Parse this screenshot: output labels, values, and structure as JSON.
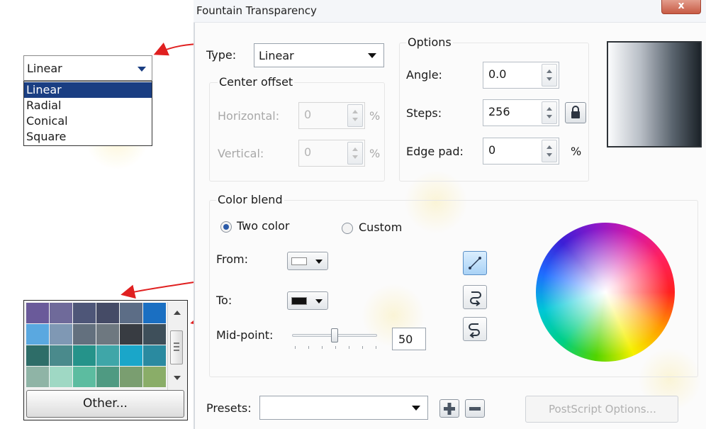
{
  "dialog": {
    "title": "Fountain Transparency",
    "close_label": "x"
  },
  "type": {
    "label": "Type:",
    "value": "Linear",
    "options": [
      "Linear",
      "Radial",
      "Conical",
      "Square"
    ],
    "selected_index": 0
  },
  "center_offset": {
    "title": "Center offset",
    "horizontal_label": "Horizontal:",
    "horizontal_value": "0",
    "vertical_label": "Vertical:",
    "vertical_value": "0",
    "unit": "%"
  },
  "options": {
    "title": "Options",
    "angle_label": "Angle:",
    "angle_value": "0.0",
    "steps_label": "Steps:",
    "steps_value": "256",
    "edge_pad_label": "Edge pad:",
    "edge_pad_value": "0",
    "unit": "%"
  },
  "color_blend": {
    "title": "Color blend",
    "two_color_label": "Two color",
    "custom_label": "Custom",
    "selected": "two_color",
    "from_label": "From:",
    "from_color": "#ffffff",
    "to_label": "To:",
    "to_color": "#111111",
    "midpoint_label": "Mid-point:",
    "midpoint_value": "50"
  },
  "presets": {
    "label": "Presets:",
    "value": "",
    "postscript_label": "PostScript Options..."
  },
  "palette": {
    "other_label": "Other...",
    "colors": [
      "#6a5a9a",
      "#6f6a9a",
      "#4e5678",
      "#454b66",
      "#5c6d86",
      "#1a6fc2",
      "#5aa8e0",
      "#7f98b4",
      "#63707e",
      "#6e7880",
      "#383c42",
      "#3e4f5a",
      "#2e6d68",
      "#4a8a8c",
      "#25938a",
      "#3fa6a8",
      "#1aa6c9",
      "#2a8aa0",
      "#8fb4a6",
      "#9fd8c4",
      "#5cbca0",
      "#4f9a82",
      "#7a9e70",
      "#8aad68"
    ]
  },
  "colors": {
    "accent": "#1a3e82",
    "arrow": "#e02020"
  }
}
